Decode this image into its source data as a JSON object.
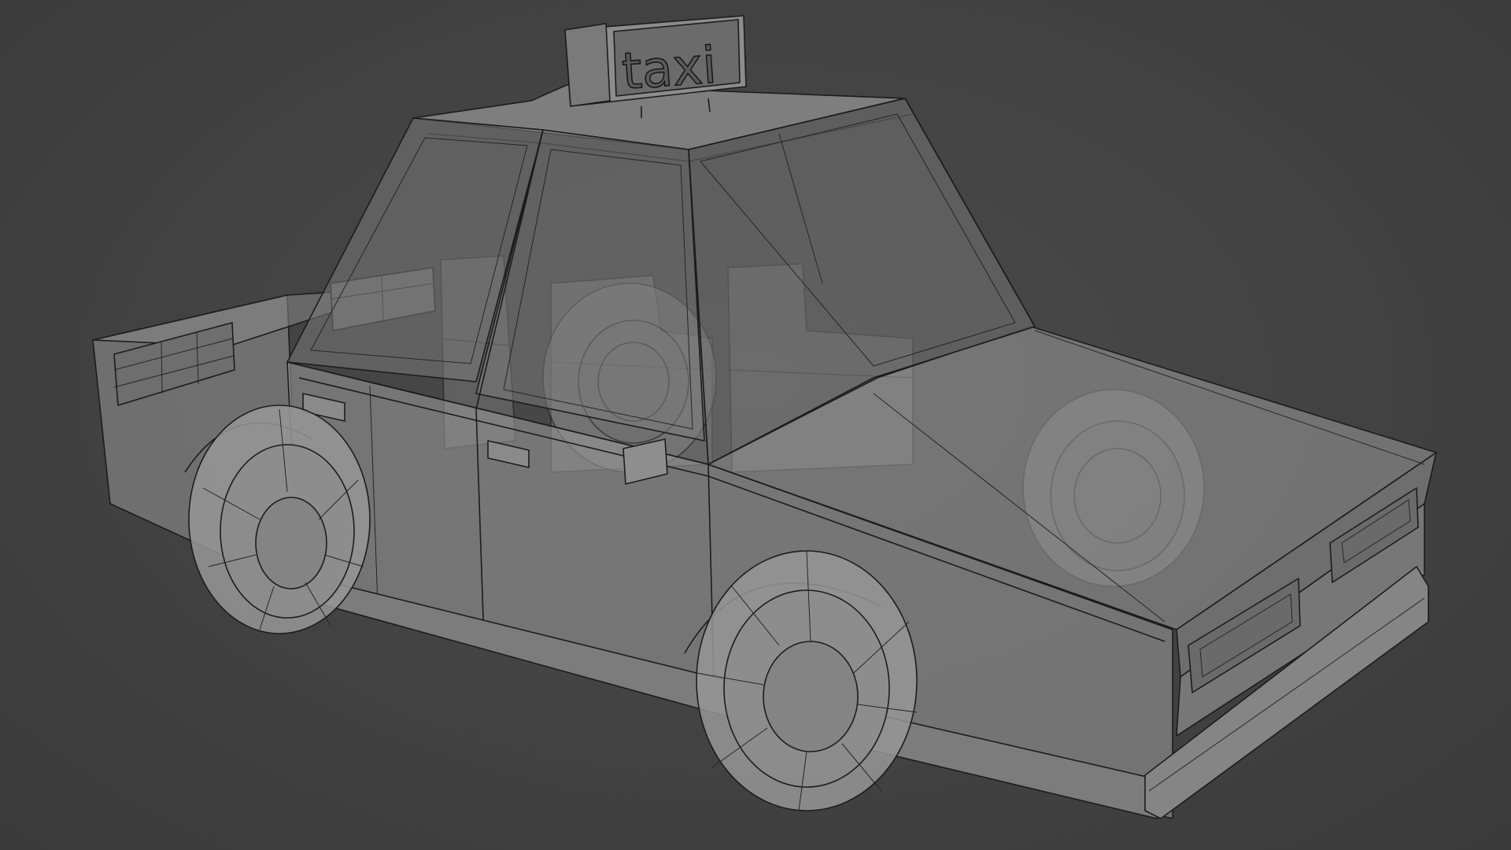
{
  "viewport": {
    "model": "taxi",
    "shading_mode": "wireframe-xray"
  },
  "scene": {
    "sign_text": "taxi"
  },
  "colors": {
    "background": "#444444",
    "body_fill": "#8c8c8c",
    "wire": "#1c1c1c"
  }
}
